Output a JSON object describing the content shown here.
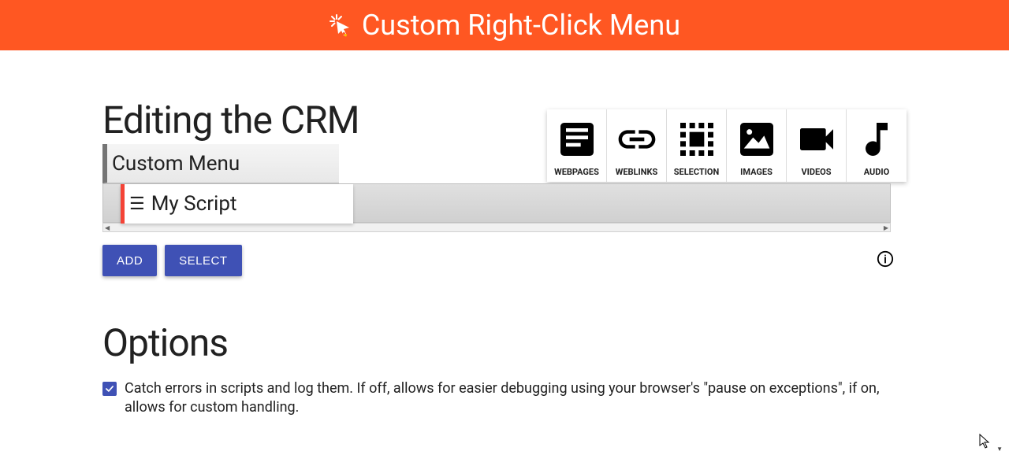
{
  "header": {
    "title": "Custom Right-Click Menu"
  },
  "editing": {
    "title": "Editing the CRM",
    "root_label": "Custom Menu",
    "item_label": "My Script"
  },
  "type_tabs": [
    {
      "id": "webpages",
      "label": "WEBPAGES"
    },
    {
      "id": "weblinks",
      "label": "WEBLINKS"
    },
    {
      "id": "selection",
      "label": "SELECTION"
    },
    {
      "id": "images",
      "label": "IMAGES"
    },
    {
      "id": "videos",
      "label": "VIDEOS"
    },
    {
      "id": "audio",
      "label": "AUDIO"
    }
  ],
  "buttons": {
    "add": "ADD",
    "select": "SELECT"
  },
  "options": {
    "title": "Options",
    "catch_errors": "Catch errors in scripts and log them. If off, allows for easier debugging using your browser's \"pause on exceptions\", if on, allows for custom handling."
  },
  "colors": {
    "accent": "#FF5722",
    "primary_button": "#3F51B5",
    "script_indicator": "#f44336"
  }
}
